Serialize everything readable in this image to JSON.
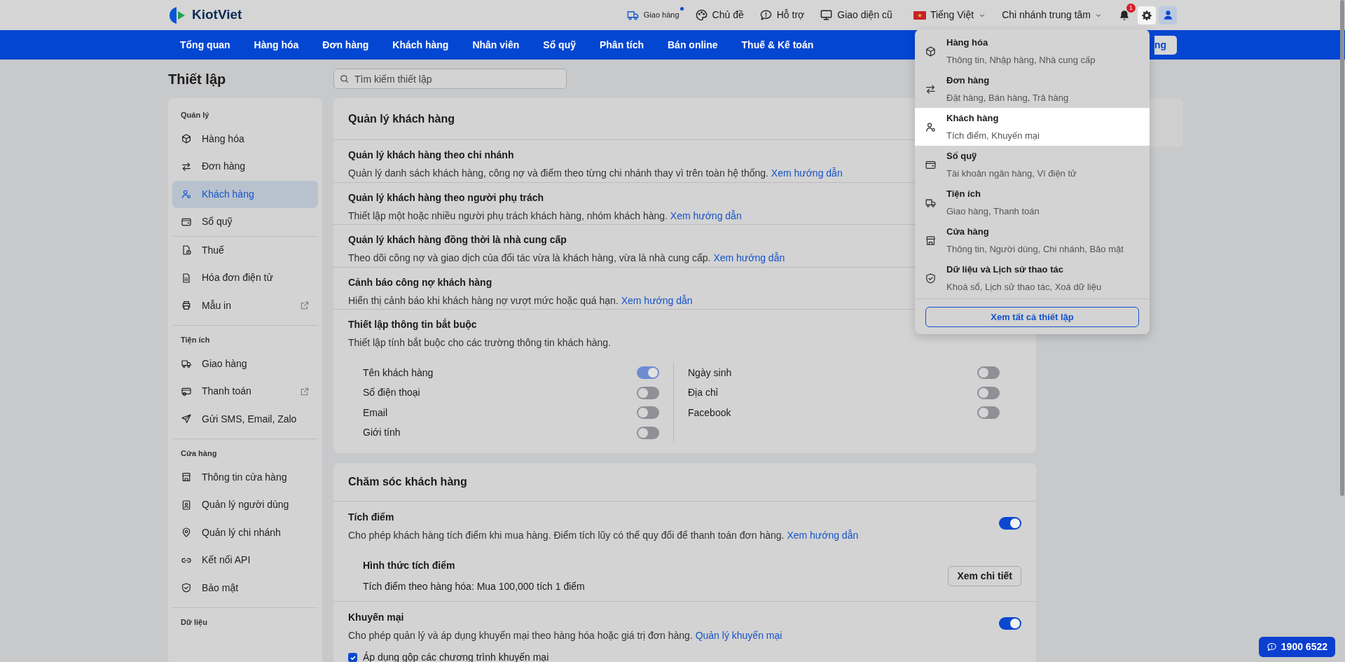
{
  "top_bar": {
    "logo": "KiotViet",
    "items": [
      {
        "kind": "delivery",
        "label": "Giao hàng",
        "dot": true
      },
      {
        "kind": "theme",
        "label": "Chủ đề"
      },
      {
        "kind": "help",
        "label": "Hỗ trợ"
      },
      {
        "kind": "classic",
        "label": "Giao diện cũ"
      }
    ],
    "language": "Tiếng Việt",
    "branch": "Chi nhánh trung tâm",
    "notification_count": "1"
  },
  "nav": {
    "items": [
      "Tổng quan",
      "Hàng hóa",
      "Đơn hàng",
      "Khách hàng",
      "Nhân viên",
      "Sổ quỹ",
      "Phân tích",
      "Bán online",
      "Thuế & Kế toán"
    ],
    "button_fragment": "ng"
  },
  "page": {
    "title": "Thiết lập",
    "search": {
      "placeholder": "Tìm kiếm thiết lập"
    }
  },
  "sidebar": {
    "groups": [
      {
        "label": "Quản lý",
        "items": [
          {
            "label": "Hàng hóa",
            "selected": false,
            "external": false
          },
          {
            "label": "Đơn hàng",
            "selected": false,
            "external": false
          },
          {
            "label": "Khách hàng",
            "selected": true,
            "external": false
          },
          {
            "label": "Sổ quỹ",
            "selected": false,
            "external": false
          },
          {
            "label": "Thuế",
            "selected": false,
            "external": false
          },
          {
            "label": "Hóa đơn điện tử",
            "selected": false,
            "external": false
          },
          {
            "label": "Mẫu in",
            "selected": false,
            "external": true
          }
        ]
      },
      {
        "label": "Tiện ích",
        "items": [
          {
            "label": "Giao hàng",
            "selected": false,
            "external": false
          },
          {
            "label": "Thanh toán",
            "selected": false,
            "external": true
          },
          {
            "label": "Gửi SMS, Email, Zalo",
            "selected": false,
            "external": false
          }
        ]
      },
      {
        "label": "Cửa hàng",
        "items": [
          {
            "label": "Thông tin cửa hàng",
            "selected": false,
            "external": false
          },
          {
            "label": "Quản lý người dùng",
            "selected": false,
            "external": false
          },
          {
            "label": "Quản lý chi nhánh",
            "selected": false,
            "external": false
          },
          {
            "label": "Kết nối API",
            "selected": false,
            "external": false
          },
          {
            "label": "Bảo mật",
            "selected": false,
            "external": false
          }
        ]
      },
      {
        "label": "Dữ liệu"
      }
    ]
  },
  "customer_management": {
    "title": "Quản lý khách hàng",
    "rows": [
      {
        "title": "Quản lý khách hàng theo chi nhánh",
        "description": "Quản lý danh sách khách hàng, công nợ và điểm theo từng chi nhánh thay vì trên toàn hệ thống.",
        "link": "Xem hướng dẫn"
      },
      {
        "title": "Quản lý khách hàng theo người phụ trách",
        "description": "Thiết lập một hoặc nhiều người phụ trách khách hàng, nhóm khách hàng.",
        "link": "Xem hướng dẫn"
      },
      {
        "title": "Quản lý khách hàng đồng thời là nhà cung cấp",
        "description": "Theo dõi công nợ và giao dịch của đối tác vừa là khách hàng, vừa là nhà cung cấp.",
        "link": "Xem hướng dẫn"
      },
      {
        "title": "Cảnh báo công nợ khách hàng",
        "description": "Hiển thị cảnh báo khi khách hàng nợ vượt mức hoặc quá hạn.",
        "link": "Xem hướng dẫn"
      }
    ],
    "required_fields": {
      "title": "Thiết lập thông tin bắt buộc",
      "description": "Thiết lập tính bắt buộc cho các trường thông tin khách hàng.",
      "left": [
        {
          "label": "Tên khách hàng",
          "on": true,
          "disabled": true
        },
        {
          "label": "Số điện thoại",
          "on": false,
          "disabled": false
        },
        {
          "label": "Email",
          "on": false,
          "disabled": false
        },
        {
          "label": "Giới tính",
          "on": false,
          "disabled": false
        }
      ],
      "right": [
        {
          "label": "Ngày sinh",
          "on": false,
          "disabled": false
        },
        {
          "label": "Địa chỉ",
          "on": false,
          "disabled": false
        },
        {
          "label": "Facebook",
          "on": false,
          "disabled": false
        }
      ]
    }
  },
  "customer_care": {
    "title": "Chăm sóc khách hàng",
    "points": {
      "title": "Tích điểm",
      "description": "Cho phép khách hàng tích điểm khi mua hàng. Điểm tích lũy có thể quy đổi để thanh toán đơn hàng.",
      "link": "Xem hướng dẫn",
      "on": true,
      "method_title": "Hình thức tích điểm",
      "method_value": "Tích điểm theo hàng hóa: Mua 100,000 tích 1 điểm",
      "button": "Xem chi tiết"
    },
    "promotion": {
      "title": "Khuyến mại",
      "description": "Cho phép quản lý và áp dụng khuyến mại theo hàng hóa hoặc giá trị đơn hàng.",
      "link": "Quản lý khuyến mại",
      "on": true,
      "option": {
        "label": "Áp dụng gộp các chương trình khuyến mại",
        "checked": true
      }
    }
  },
  "settings_menu": {
    "items": [
      {
        "title": "Hàng hóa",
        "subtitle": "Thông tin, Nhập hàng, Nhà cung cấp",
        "selected": false
      },
      {
        "title": "Đơn hàng",
        "subtitle": "Đặt hàng, Bán hàng, Trả hàng",
        "selected": false
      },
      {
        "title": "Khách hàng",
        "subtitle": "Tích điểm, Khuyến mại",
        "selected": true
      },
      {
        "title": "Sổ quỹ",
        "subtitle": "Tài khoản ngân hàng, Ví điện tử",
        "selected": false
      },
      {
        "title": "Tiện ích",
        "subtitle": "Giao hàng, Thanh toán",
        "selected": false
      },
      {
        "title": "Cửa hàng",
        "subtitle": "Thông tin, Người dùng, Chi nhánh, Bảo mật",
        "selected": false
      },
      {
        "title": "Dữ liệu và Lịch sử thao tác",
        "subtitle": "Khoá sổ, Lịch sử thao tác, Xoá dữ liệu",
        "selected": false
      }
    ],
    "footer_button": "Xem tất cả thiết lập"
  },
  "hotline": "1900 6522"
}
